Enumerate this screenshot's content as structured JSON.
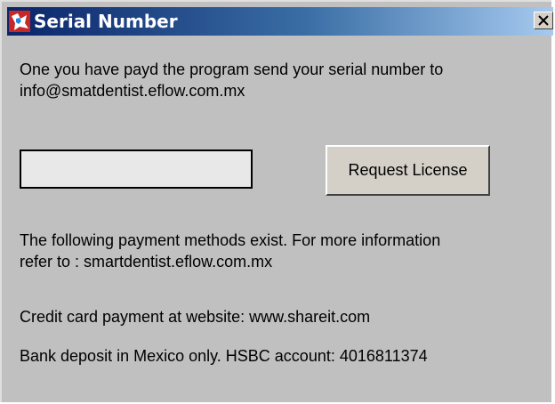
{
  "window": {
    "title": "Serial Number",
    "icons": {
      "app": "app-icon",
      "close": "close-icon"
    }
  },
  "instructions": {
    "line1": "One you have payd the program send your serial number to",
    "line2": "info@smatdentist.eflow.com.mx"
  },
  "serial_input": {
    "value": "",
    "placeholder": ""
  },
  "request_button": {
    "label": "Request License"
  },
  "payment_info": {
    "line1": "The following payment methods exist. For more information",
    "line2": "refer to : smartdentist.eflow.com.mx",
    "credit_card": "Credit card payment at website: www.shareit.com",
    "bank_deposit": "Bank deposit in Mexico only. HSBC account: 4016811374"
  },
  "colors": {
    "title_bar_start": "#0a246a",
    "title_bar_end": "#a6caf0",
    "window_background": "#c0c0c0"
  }
}
